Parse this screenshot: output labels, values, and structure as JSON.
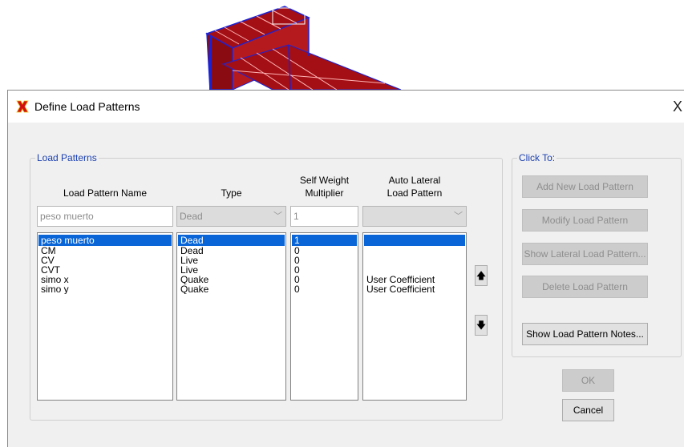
{
  "window": {
    "title": "Define Load Patterns",
    "close_glyph": "X",
    "icon": "sap2000-app-icon"
  },
  "load_patterns_group": {
    "legend": "Load Patterns",
    "headers": {
      "name": "Load Pattern Name",
      "type": "Type",
      "self_weight_line1": "Self Weight",
      "self_weight_line2": "Multiplier",
      "auto_lateral_line1": "Auto Lateral",
      "auto_lateral_line2": "Load Pattern"
    },
    "inputs": {
      "name_value": "peso muerto",
      "type_value": "Dead",
      "multiplier_value": "1",
      "auto_lateral_value": ""
    },
    "rows": [
      {
        "name": "peso muerto",
        "type": "Dead",
        "multiplier": "1",
        "auto_lateral": ""
      },
      {
        "name": "CM",
        "type": "Dead",
        "multiplier": "0",
        "auto_lateral": ""
      },
      {
        "name": "CV",
        "type": "Live",
        "multiplier": "0",
        "auto_lateral": ""
      },
      {
        "name": "CVT",
        "type": "Live",
        "multiplier": "0",
        "auto_lateral": ""
      },
      {
        "name": "simo x",
        "type": "Quake",
        "multiplier": "0",
        "auto_lateral": "User Coefficient"
      },
      {
        "name": "simo y",
        "type": "Quake",
        "multiplier": "0",
        "auto_lateral": "User Coefficient"
      }
    ],
    "move_up_glyph": "🡅",
    "move_down_glyph": "🡇"
  },
  "click_to_group": {
    "legend": "Click To:",
    "buttons": {
      "add": "Add New Load Pattern",
      "modify": "Modify Load Pattern",
      "show_lateral": "Show Lateral Load Pattern...",
      "delete": "Delete Load Pattern",
      "notes": "Show Load Pattern Notes..."
    }
  },
  "footer": {
    "ok": "OK",
    "cancel": "Cancel"
  },
  "colors": {
    "selection": "#0a66d6",
    "legend_text": "#1a3fb0",
    "model_fill": "#a30f15",
    "model_frame": "#1a22d6"
  }
}
